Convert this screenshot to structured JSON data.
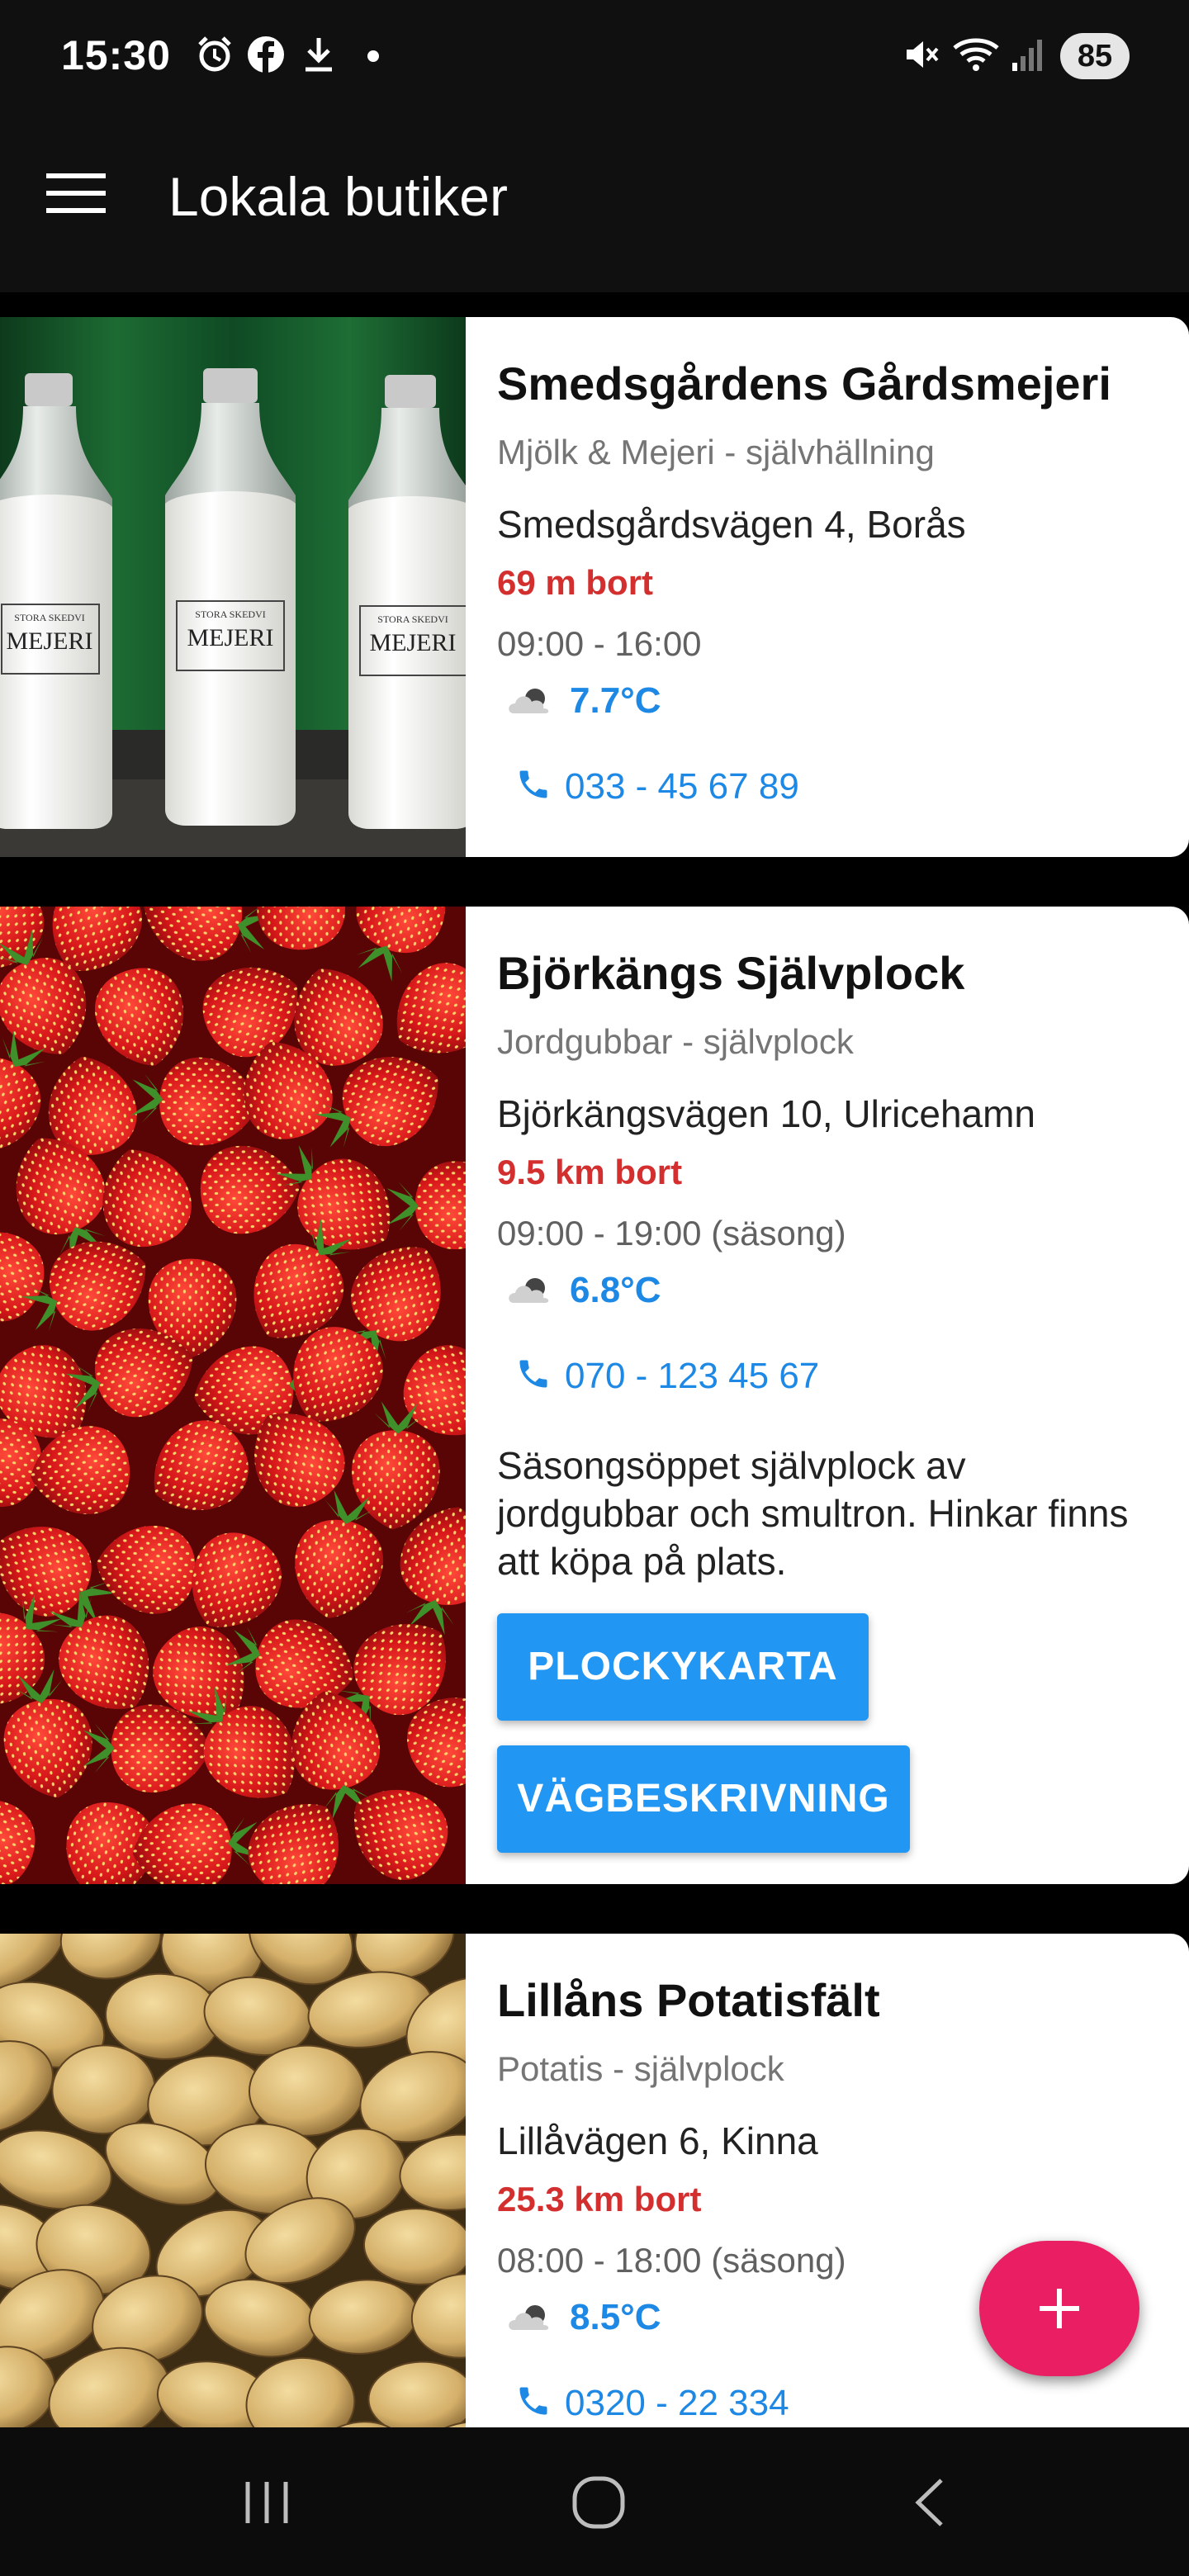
{
  "status_bar": {
    "time": "15:30",
    "battery": "85",
    "left_icons": [
      "alarm-icon",
      "facebook-icon",
      "download-icon",
      "notification-dot-icon"
    ],
    "right_icons": [
      "mute-icon",
      "wifi-icon",
      "signal-icon",
      "battery-icon"
    ]
  },
  "app_bar": {
    "title": "Lokala butiker",
    "menu_icon": "hamburger-menu-icon"
  },
  "shops": [
    {
      "name": "Smedsgårdens Gårdsmejeri",
      "category": "Mjölk & Mejeri - självhällning",
      "address": "Smedsgårdsvägen 4, Borås",
      "distance": "69 m bort",
      "hours": "09:00 - 16:00",
      "temperature": "7.7°C",
      "phone": "033 - 45 67 89",
      "image": "milk-bottles-photo",
      "bottle_label_top": "STORA SKEDVI",
      "bottle_label_main": "MEJERI"
    },
    {
      "name": "Björkängs Självplock",
      "category": "Jordgubbar - självplock",
      "address": "Björkängsvägen 10, Ulricehamn",
      "distance": "9.5 km bort",
      "hours": "09:00 - 19:00 (säsong)",
      "temperature": "6.8°C",
      "phone": "070 - 123 45 67",
      "description": "Säsongsöppet självplock av jordgubbar och smultron. Hinkar finns att köpa på plats.",
      "buttons": [
        "PLOCKYKARTA",
        "VÄGBESKRIVNING"
      ],
      "image": "strawberries-photo"
    },
    {
      "name": "Lillåns Potatisfält",
      "category": "Potatis - självplock",
      "address": "Lillåvägen 6, Kinna",
      "distance": "25.3 km bort",
      "hours": "08:00 - 18:00 (säsong)",
      "temperature": "8.5°C",
      "phone": "0320 - 22 334",
      "image": "potatoes-photo"
    }
  ],
  "fab": {
    "icon": "plus-icon"
  },
  "nav_bar": {
    "buttons": [
      "recent-apps-icon",
      "home-icon",
      "back-icon"
    ]
  },
  "colors": {
    "bar_background": "#101010",
    "distance": "#d32f2f",
    "link_blue": "#1e88e5",
    "button_blue": "#2196f3",
    "fab_pink": "#e91e63"
  }
}
